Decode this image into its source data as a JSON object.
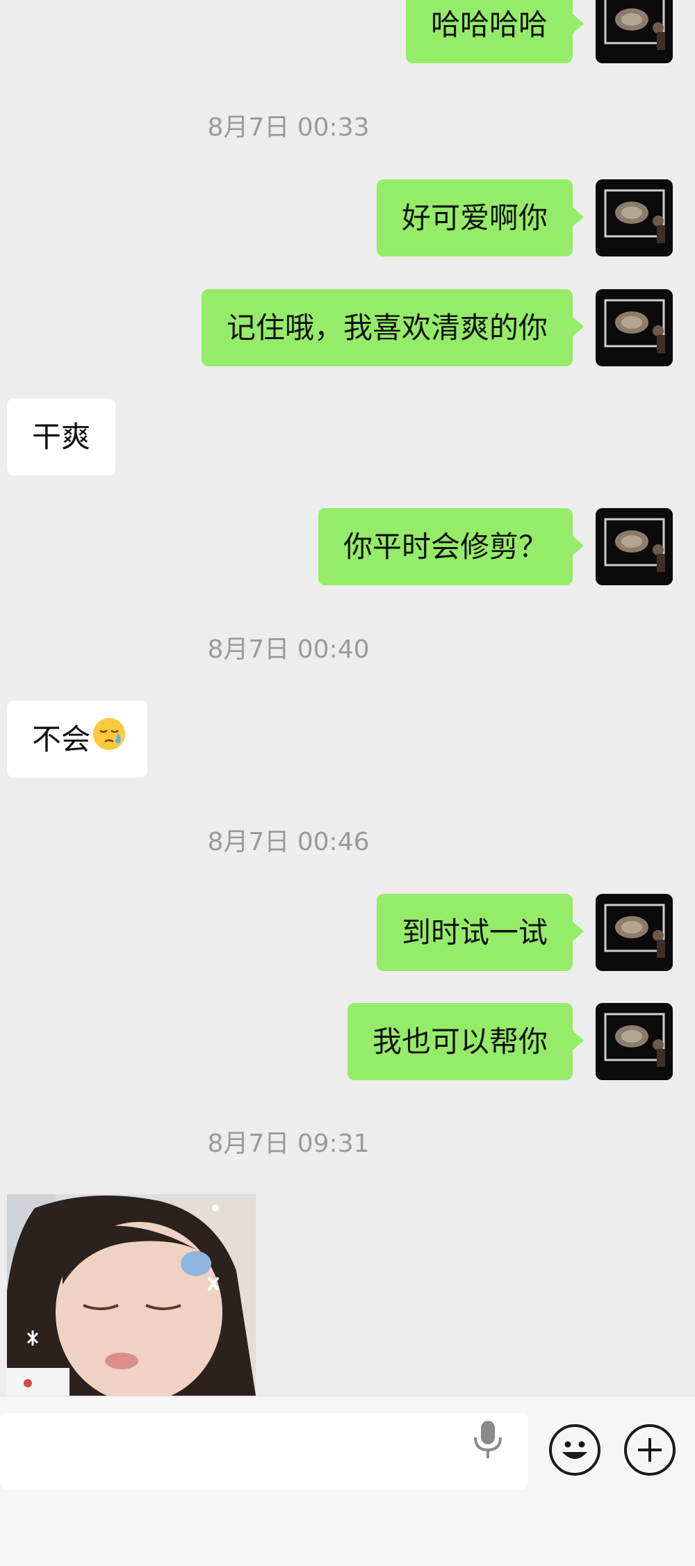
{
  "messages": [
    {
      "direction": "out",
      "text": "哈哈哈哈"
    },
    {
      "type": "timestamp",
      "text": "8月7日 00:33"
    },
    {
      "direction": "out",
      "text": "好可爱啊你"
    },
    {
      "direction": "out",
      "text": "记住哦，我喜欢清爽的你"
    },
    {
      "direction": "in",
      "text": "干爽"
    },
    {
      "direction": "out",
      "text": "你平时会修剪？"
    },
    {
      "type": "timestamp",
      "text": "8月7日 00:40"
    },
    {
      "direction": "in",
      "text": "不会",
      "emoji": "sleepy-face-icon"
    },
    {
      "type": "timestamp",
      "text": "8月7日 00:46"
    },
    {
      "direction": "out",
      "text": "到时试一试"
    },
    {
      "direction": "out",
      "text": "我也可以帮你"
    },
    {
      "type": "timestamp",
      "text": "8月7日 09:31"
    },
    {
      "direction": "in",
      "type": "image",
      "icon": "photo-sleeping-girl"
    }
  ],
  "input_bar": {
    "text_field_value": "",
    "icons": [
      "microphone-icon",
      "emoji-icon",
      "plus-icon"
    ]
  },
  "colors": {
    "background": "#ededed",
    "outgoing_bubble": "#95ec69",
    "incoming_bubble": "#ffffff",
    "timestamp": "#9a9a9a"
  }
}
